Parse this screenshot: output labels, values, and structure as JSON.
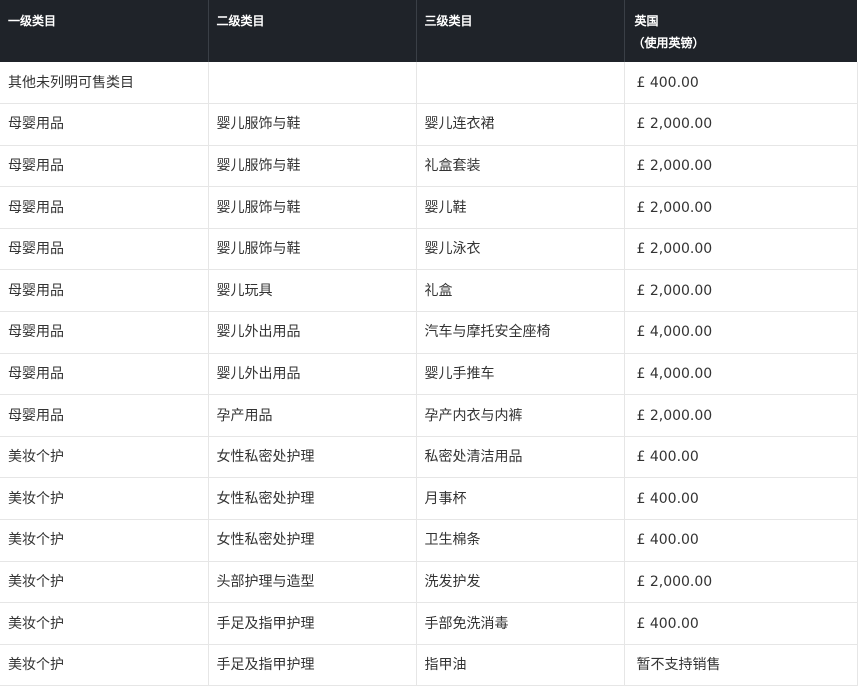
{
  "table": {
    "headers": [
      "一级类目",
      "二级类目",
      "三级类目",
      "英国",
      "（使用英镑）"
    ],
    "rows": [
      [
        "其他未列明可售类目",
        "",
        "",
        "£ 400.00"
      ],
      [
        "母婴用品",
        "婴儿服饰与鞋",
        "婴儿连衣裙",
        "£ 2,000.00"
      ],
      [
        "母婴用品",
        "婴儿服饰与鞋",
        "礼盒套装",
        "£ 2,000.00"
      ],
      [
        "母婴用品",
        "婴儿服饰与鞋",
        "婴儿鞋",
        "£ 2,000.00"
      ],
      [
        "母婴用品",
        "婴儿服饰与鞋",
        "婴儿泳衣",
        "£ 2,000.00"
      ],
      [
        "母婴用品",
        "婴儿玩具",
        "礼盒",
        "£ 2,000.00"
      ],
      [
        "母婴用品",
        "婴儿外出用品",
        "汽车与摩托安全座椅",
        "£ 4,000.00"
      ],
      [
        "母婴用品",
        "婴儿外出用品",
        "婴儿手推车",
        "£ 4,000.00"
      ],
      [
        "母婴用品",
        "孕产用品",
        "孕产内衣与内裤",
        "£ 2,000.00"
      ],
      [
        "美妆个护",
        "女性私密处护理",
        "私密处清洁用品",
        "£ 400.00"
      ],
      [
        "美妆个护",
        "女性私密处护理",
        "月事杯",
        "£ 400.00"
      ],
      [
        "美妆个护",
        "女性私密处护理",
        "卫生棉条",
        "£ 400.00"
      ],
      [
        "美妆个护",
        "头部护理与造型",
        "洗发护发",
        "£ 2,000.00"
      ],
      [
        "美妆个护",
        "手足及指甲护理",
        "手部免洗消毒",
        "£ 400.00"
      ],
      [
        "美妆个护",
        "手足及指甲护理",
        "指甲油",
        "暂不支持销售"
      ]
    ]
  }
}
